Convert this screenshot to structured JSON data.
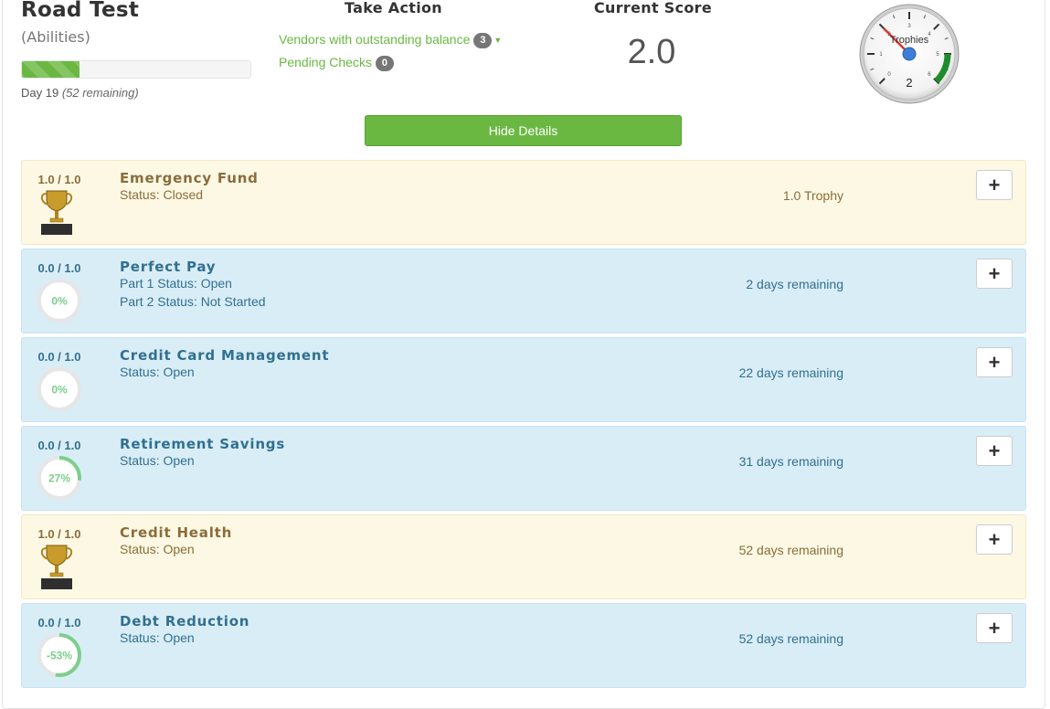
{
  "header": {
    "title": "Road Test",
    "subtitle": "(Abilities)",
    "progress_fraction": 0.25,
    "day_label": "Day 19",
    "day_remaining": "(52 remaining)"
  },
  "take_action": {
    "heading": "Take Action",
    "items": [
      {
        "label": "Vendors with outstanding balance",
        "count": "3",
        "has_caret": true
      },
      {
        "label": "Pending Checks",
        "count": "0",
        "has_caret": false
      }
    ]
  },
  "current_score": {
    "heading": "Current Score",
    "value": "2.0"
  },
  "gauge": {
    "label": "Trophies",
    "value_text": "2",
    "ticks": [
      "0",
      "1",
      "2",
      "3",
      "4",
      "5",
      "6"
    ],
    "value": 2,
    "max": 6,
    "band_color": "#1e8c2b"
  },
  "hide_button": "Hide Details",
  "colors": {
    "accent": "#6ab842",
    "gold_bg": "#fcf8e3",
    "blue_bg": "#d9edf7",
    "ring_green": "#7ccf8c"
  },
  "abilities": [
    {
      "score": "1.0 / 1.0",
      "name": "Emergency Fund",
      "status": [
        "Status: Closed"
      ],
      "remaining": "1.0 Trophy",
      "style": "gold",
      "badge": "trophy-icon"
    },
    {
      "score": "0.0 / 1.0",
      "name": "Perfect Pay",
      "status": [
        "Part 1 Status: Open",
        "Part 2 Status: Not Started"
      ],
      "remaining": "2 days remaining",
      "style": "blue",
      "badge": "progress-ring",
      "percent_text": "0%",
      "percent": 0
    },
    {
      "score": "0.0 / 1.0",
      "name": "Credit Card Management",
      "status": [
        "Status: Open"
      ],
      "remaining": "22 days remaining",
      "style": "blue",
      "badge": "progress-ring",
      "percent_text": "0%",
      "percent": 0
    },
    {
      "score": "0.0 / 1.0",
      "name": "Retirement Savings",
      "status": [
        "Status: Open"
      ],
      "remaining": "31 days remaining",
      "style": "blue",
      "badge": "progress-ring",
      "percent_text": "27%",
      "percent": 27
    },
    {
      "score": "1.0 / 1.0",
      "name": "Credit Health",
      "status": [
        "Status: Open"
      ],
      "remaining": "52 days remaining",
      "style": "gold",
      "badge": "trophy-icon"
    },
    {
      "score": "0.0 / 1.0",
      "name": "Debt Reduction",
      "status": [
        "Status: Open"
      ],
      "remaining": "52 days remaining",
      "style": "blue",
      "badge": "progress-ring",
      "percent_text": "-53%",
      "percent": -53
    }
  ],
  "expand_symbol": "+"
}
